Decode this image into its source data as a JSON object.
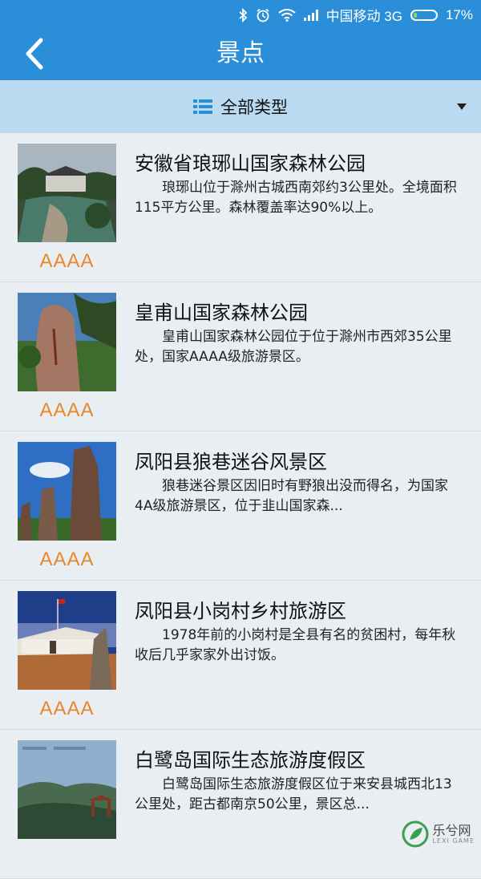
{
  "status_bar": {
    "carrier": "中国移动 3G",
    "battery": "17%",
    "battery_level": 0.17,
    "icons": [
      "bluetooth-icon",
      "alarm-icon",
      "wifi-icon",
      "signal-icon",
      "battery-icon"
    ]
  },
  "header": {
    "title": "景点",
    "back_icon": "chevron-left-icon"
  },
  "filter": {
    "label": "全部类型",
    "icon": "list-icon"
  },
  "items": [
    {
      "name": "安徽省琅琊山国家森林公园",
      "desc": "琅琊山位于滁州古城西南郊约3公里处。全境面积115平方公里。森林覆盖率达90%以上。",
      "rating": "AAAA"
    },
    {
      "name": "皇甫山国家森林公园",
      "desc": "皇甫山国家森林公园位于位于滁州市西郊35公里处，国家AAAA级旅游景区。",
      "rating": "AAAA"
    },
    {
      "name": "凤阳县狼巷迷谷风景区",
      "desc": "狼巷迷谷景区因旧时有野狼出没而得名，为国家4A级旅游景区，位于韭山国家森...",
      "rating": "AAAA"
    },
    {
      "name": "凤阳县小岗村乡村旅游区",
      "desc": "1978年前的小岗村是全县有名的贫困村，每年秋收后几乎家家外出讨饭。",
      "rating": "AAAA"
    },
    {
      "name": "白鹭岛国际生态旅游度假区",
      "desc": "白鹭岛国际生态旅游度假区位于来安县城西北13公里处，距古都南京50公里，景区总...",
      "rating": ""
    }
  ],
  "watermark": {
    "text": "乐兮网",
    "sub": "LEXI GAME"
  },
  "colors": {
    "primary": "#2a8fd8",
    "filter_bg": "#b9daf0",
    "rating": "#e8882a",
    "list_bg": "#e9eef2"
  }
}
